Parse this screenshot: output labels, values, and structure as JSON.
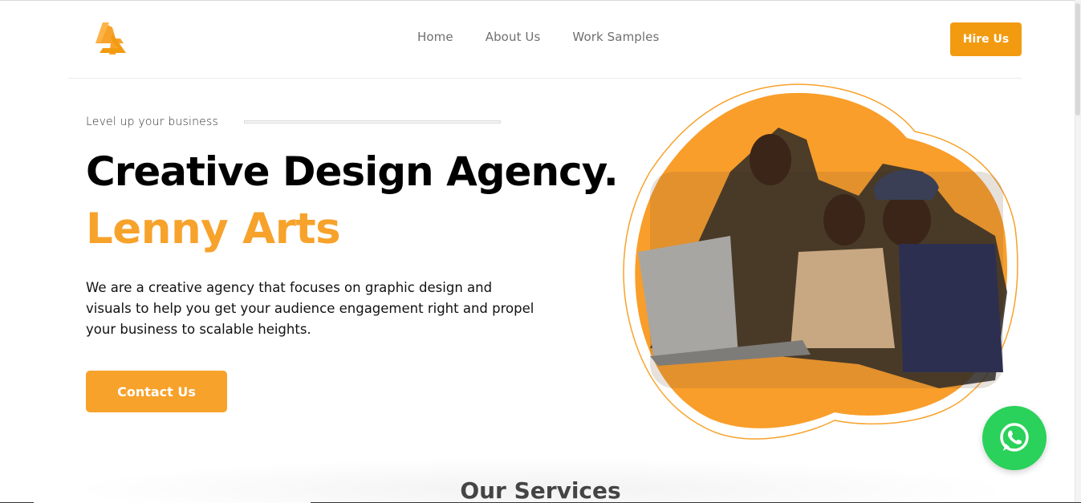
{
  "brand": {
    "logo_icon": "lenny-arts-logo-icon",
    "accent_color": "#F7A22B",
    "button_color": "#F29B11"
  },
  "nav": {
    "items": [
      {
        "label": "Home"
      },
      {
        "label": "About Us"
      },
      {
        "label": "Work Samples"
      }
    ],
    "cta_label": "Hire Us"
  },
  "hero": {
    "tagline": "Level up your business",
    "headline": "Creative Design Agency.",
    "subheadline": "Lenny Arts",
    "description": "We are a creative agency that focuses on graphic design and visuals to help you get your audience engagement right and propel your business to scalable heights.",
    "cta_label": "Contact Us",
    "image_icon": "team-photo-blob"
  },
  "services": {
    "title": "Our Services"
  },
  "floating": {
    "whatsapp_icon": "whatsapp-icon",
    "whatsapp_color": "#2AD15A"
  }
}
